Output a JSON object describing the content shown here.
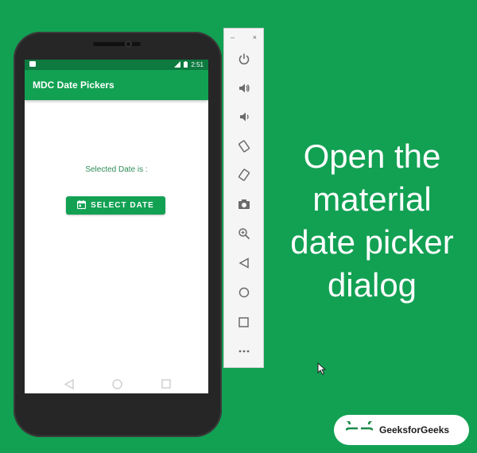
{
  "status_bar": {
    "signal": "LTE",
    "time": "2:51"
  },
  "app": {
    "title": "MDC Date Pickers",
    "selected_date_label": "Selected Date is :",
    "select_button_label": "SELECT DATE"
  },
  "nav": {
    "back_icon": "back-triangle",
    "home_icon": "home-circle",
    "recents_icon": "recents-square"
  },
  "emulator_toolbar": {
    "minimize": "–",
    "close": "×",
    "items": [
      "power",
      "volume-up",
      "volume-down",
      "rotate-left",
      "rotate-right",
      "camera",
      "zoom",
      "back",
      "home",
      "overview",
      "more"
    ]
  },
  "caption": {
    "line1": "Open the",
    "line2": "material",
    "line3": "date picker",
    "line4": "dialog"
  },
  "logo": {
    "text": "GeeksforGeeks"
  },
  "colors": {
    "background": "#12a153",
    "status_bar": "#0d7a3f",
    "button": "#12a153",
    "phone_body": "#262626"
  }
}
